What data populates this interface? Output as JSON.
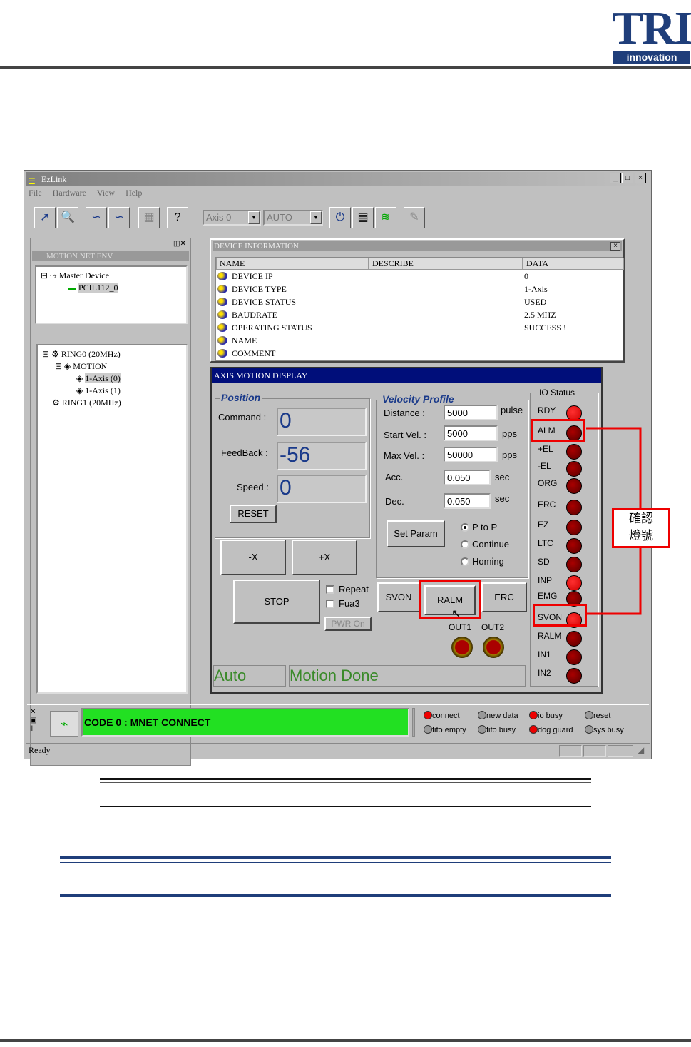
{
  "logo": {
    "main": "TRI",
    "sub": "innovation"
  },
  "window": {
    "title": "EzLink",
    "menu": [
      "File",
      "Hardware",
      "View",
      "Help"
    ],
    "toolbar": {
      "axis_select": "Axis 0",
      "mode_select": "AUTO"
    },
    "left_panel": {
      "header": "MOTION NET ENV",
      "tree1": {
        "root": "Master Device",
        "child": "PCIL112_0"
      },
      "tree2": {
        "ring0": "RING0 (20MHz)",
        "motion": "MOTION",
        "axis0": "1-Axis (0)",
        "axis1": "1-Axis (1)",
        "ring1": "RING1 (20MHz)"
      }
    },
    "device_info": {
      "title": "DEVICE INFORMATION",
      "columns": [
        "NAME",
        "DESCRIBE",
        "DATA"
      ],
      "rows": [
        {
          "name": "DEVICE IP",
          "data": "0"
        },
        {
          "name": "DEVICE TYPE",
          "data": "1-Axis"
        },
        {
          "name": "DEVICE STATUS",
          "data": "USED"
        },
        {
          "name": "BAUDRATE",
          "data": "2.5 MHZ"
        },
        {
          "name": "OPERATING STATUS",
          "data": "SUCCESS !"
        },
        {
          "name": "NAME",
          "data": ""
        },
        {
          "name": "COMMENT",
          "data": ""
        }
      ]
    },
    "axis": {
      "title": "AXIS MOTION DISPLAY",
      "position": {
        "label": "Position",
        "command_label": "Command :",
        "command": "0",
        "feedback_label": "FeedBack :",
        "feedback": "-56",
        "speed_label": "Speed :",
        "speed": "0",
        "reset": "RESET"
      },
      "velocity": {
        "label": "Velocity Profile",
        "distance_label": "Distance :",
        "distance": "5000",
        "distance_unit": "pulse",
        "start_label": "Start Vel. :",
        "start": "5000",
        "start_unit": "pps",
        "max_label": "Max Vel. :",
        "max": "50000",
        "max_unit": "pps",
        "acc_label": "Acc.",
        "acc": "0.050",
        "acc_unit": "sec",
        "dec_label": "Dec.",
        "dec": "0.050",
        "dec_unit": "sec",
        "set_param": "Set Param",
        "modes": [
          "P to P",
          "Continue",
          "Homing"
        ]
      },
      "buttons": {
        "minus_x": "-X",
        "plus_x": "+X",
        "stop": "STOP",
        "repeat": "Repeat",
        "fua3": "Fua3",
        "pwr_on": "PWR On",
        "svon": "SVON",
        "ralm": "RALM",
        "erc": "ERC"
      },
      "outputs": [
        "OUT1",
        "OUT2"
      ],
      "io_status": {
        "label": "IO Status",
        "items": [
          {
            "name": "RDY",
            "state": "on"
          },
          {
            "name": "ALM",
            "state": "off"
          },
          {
            "name": "+EL",
            "state": "off"
          },
          {
            "name": "-EL",
            "state": "off"
          },
          {
            "name": "ORG",
            "state": "off"
          },
          {
            "name": "ERC",
            "state": "off"
          },
          {
            "name": "EZ",
            "state": "off"
          },
          {
            "name": "LTC",
            "state": "off"
          },
          {
            "name": "SD",
            "state": "off"
          },
          {
            "name": "INP",
            "state": "on"
          },
          {
            "name": "EMG",
            "state": "off"
          },
          {
            "name": "SVON",
            "state": "on"
          },
          {
            "name": "RALM",
            "state": "off"
          },
          {
            "name": "IN1",
            "state": "off"
          },
          {
            "name": "IN2",
            "state": "off"
          }
        ]
      },
      "status_mode": "Auto",
      "status_msg": "Motion Done"
    },
    "annotation": "確認\n燈號",
    "bottom": {
      "code": "CODE 0 : MNET CONNECT",
      "flags": [
        {
          "label": "connect",
          "state": "red"
        },
        {
          "label": "new data",
          "state": "gray"
        },
        {
          "label": "io busy",
          "state": "red"
        },
        {
          "label": "reset",
          "state": "gray"
        },
        {
          "label": "fifo empty",
          "state": "gray"
        },
        {
          "label": "fifo busy",
          "state": "gray"
        },
        {
          "label": "dog guard",
          "state": "red"
        },
        {
          "label": "sys busy",
          "state": "gray"
        }
      ],
      "status": "Ready"
    }
  }
}
